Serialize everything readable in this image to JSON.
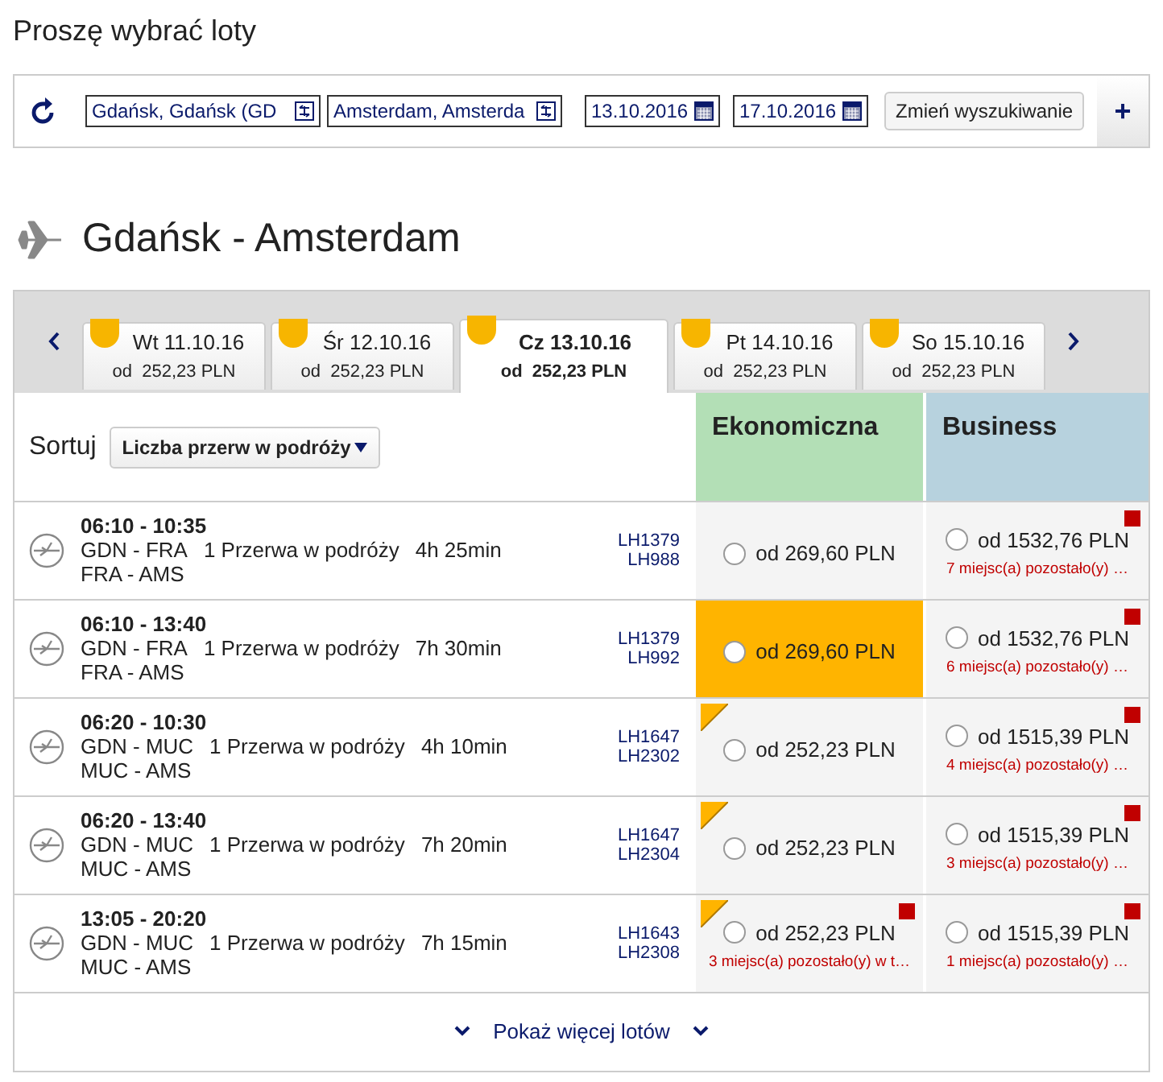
{
  "page_title": "Proszę wybrać loty",
  "search": {
    "origin": "Gdańsk, Gdańsk (GD",
    "destination": "Amsterdam, Amsterda",
    "depart_date": "13.10.2016",
    "return_date": "17.10.2016",
    "change_button": "Zmień wyszukiwanie",
    "add_button": "+"
  },
  "route_heading": "Gdańsk - Amsterdam",
  "date_tabs": [
    {
      "day": "Wt 11.10.16",
      "price": "od  252,23 PLN",
      "selected": false
    },
    {
      "day": "Śr 12.10.16",
      "price": "od  252,23 PLN",
      "selected": false
    },
    {
      "day": "Cz 13.10.16",
      "price": "od  252,23 PLN",
      "selected": true
    },
    {
      "day": "Pt 14.10.16",
      "price": "od  252,23 PLN",
      "selected": false
    },
    {
      "day": "So 15.10.16",
      "price": "od  252,23 PLN",
      "selected": false
    }
  ],
  "sort": {
    "label": "Sortuj",
    "value": "Liczba przerw w podróży"
  },
  "fare_columns": [
    {
      "name": "Ekonomiczna",
      "color": "#b3dfb6"
    },
    {
      "name": "Business",
      "color": "#b7d2de"
    }
  ],
  "flights": [
    {
      "times": "06:10 - 10:35",
      "leg1": "GDN - FRA",
      "stops": "1 Przerwa w podróży",
      "duration": "4h 25min",
      "leg2": "FRA - AMS",
      "numbers": [
        "LH1379",
        "LH988"
      ],
      "fares": [
        {
          "price": "od 269,60 PLN",
          "selected": false,
          "best_price": false,
          "limited": false
        },
        {
          "price": "od 1532,76 PLN",
          "selected": false,
          "best_price": false,
          "limited": true,
          "seats": "7 miejsc(a) pozostało(y) …"
        }
      ]
    },
    {
      "times": "06:10 - 13:40",
      "leg1": "GDN - FRA",
      "stops": "1 Przerwa w podróży",
      "duration": "7h 30min",
      "leg2": "FRA - AMS",
      "numbers": [
        "LH1379",
        "LH992"
      ],
      "fares": [
        {
          "price": "od 269,60 PLN",
          "selected": true,
          "best_price": false,
          "limited": false
        },
        {
          "price": "od 1532,76 PLN",
          "selected": false,
          "best_price": false,
          "limited": true,
          "seats": "6 miejsc(a) pozostało(y) …"
        }
      ]
    },
    {
      "times": "06:20 - 10:30",
      "leg1": "GDN - MUC",
      "stops": "1 Przerwa w podróży",
      "duration": "4h 10min",
      "leg2": "MUC - AMS",
      "numbers": [
        "LH1647",
        "LH2302"
      ],
      "fares": [
        {
          "price": "od 252,23 PLN",
          "selected": false,
          "best_price": true,
          "limited": false
        },
        {
          "price": "od 1515,39 PLN",
          "selected": false,
          "best_price": false,
          "limited": true,
          "seats": "4 miejsc(a) pozostało(y) …"
        }
      ]
    },
    {
      "times": "06:20 - 13:40",
      "leg1": "GDN - MUC",
      "stops": "1 Przerwa w podróży",
      "duration": "7h 20min",
      "leg2": "MUC - AMS",
      "numbers": [
        "LH1647",
        "LH2304"
      ],
      "fares": [
        {
          "price": "od 252,23 PLN",
          "selected": false,
          "best_price": true,
          "limited": false
        },
        {
          "price": "od 1515,39 PLN",
          "selected": false,
          "best_price": false,
          "limited": true,
          "seats": "3 miejsc(a) pozostało(y) …"
        }
      ]
    },
    {
      "times": "13:05 - 20:20",
      "leg1": "GDN - MUC",
      "stops": "1 Przerwa w podróży",
      "duration": "7h 15min",
      "leg2": "MUC - AMS",
      "numbers": [
        "LH1643",
        "LH2308"
      ],
      "fares": [
        {
          "price": "od 252,23 PLN",
          "selected": false,
          "best_price": true,
          "limited": true,
          "seats": "3 miejsc(a) pozostało(y) w t…"
        },
        {
          "price": "od 1515,39 PLN",
          "selected": false,
          "best_price": false,
          "limited": true,
          "seats": "1 miejsc(a) pozostało(y) …"
        }
      ]
    }
  ],
  "more_link": "Pokaż więcej lotów"
}
